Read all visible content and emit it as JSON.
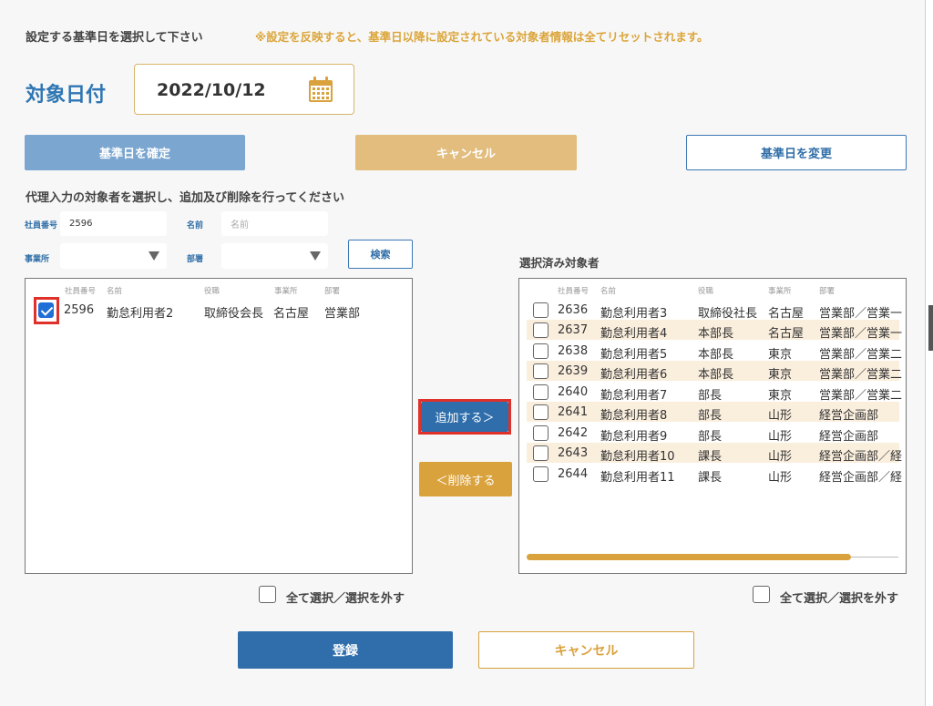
{
  "header": {
    "instruction": "設定する基準日を選択して下さい",
    "warning": "※設定を反映すると、基準日以降に設定されている対象者情報は全てリセットされます。"
  },
  "target_date": {
    "label": "対象日付",
    "value": "2022/10/12",
    "icon": "calendar-icon"
  },
  "date_buttons": {
    "confirm": "基準日を確定",
    "cancel": "キャンセル",
    "change": "基準日を変更"
  },
  "proxy": {
    "instruction": "代理入力の対象者を選択し、追加及び削除を行ってください"
  },
  "filters": {
    "employee_no_label": "社員番号",
    "employee_no_value": "2596",
    "name_label": "名前",
    "name_placeholder": "名前",
    "office_label": "事業所",
    "office_value": "",
    "dept_label": "部署",
    "dept_value": "",
    "search_button": "検索"
  },
  "columns": {
    "emp_no": "社員番号",
    "name": "名前",
    "position": "役職",
    "office": "事業所",
    "dept": "部署"
  },
  "left_list": [
    {
      "checked": true,
      "emp_no": "2596",
      "name": "勤怠利用者2",
      "position": "取締役会長",
      "office": "名古屋",
      "dept": "営業部"
    }
  ],
  "middle": {
    "add_button": "追加する＞",
    "remove_button": "＜削除する"
  },
  "selected": {
    "title": "選択済み対象者",
    "rows": [
      {
        "checked": false,
        "emp_no": "2636",
        "name": "勤怠利用者3",
        "position": "取締役社長",
        "office": "名古屋",
        "dept": "営業部／営業一"
      },
      {
        "checked": false,
        "emp_no": "2637",
        "name": "勤怠利用者4",
        "position": "本部長",
        "office": "名古屋",
        "dept": "営業部／営業一"
      },
      {
        "checked": false,
        "emp_no": "2638",
        "name": "勤怠利用者5",
        "position": "本部長",
        "office": "東京",
        "dept": "営業部／営業二"
      },
      {
        "checked": false,
        "emp_no": "2639",
        "name": "勤怠利用者6",
        "position": "本部長",
        "office": "東京",
        "dept": "営業部／営業二"
      },
      {
        "checked": false,
        "emp_no": "2640",
        "name": "勤怠利用者7",
        "position": "部長",
        "office": "東京",
        "dept": "営業部／営業二"
      },
      {
        "checked": false,
        "emp_no": "2641",
        "name": "勤怠利用者8",
        "position": "部長",
        "office": "山形",
        "dept": "経営企画部"
      },
      {
        "checked": false,
        "emp_no": "2642",
        "name": "勤怠利用者9",
        "position": "部長",
        "office": "山形",
        "dept": "経営企画部"
      },
      {
        "checked": false,
        "emp_no": "2643",
        "name": "勤怠利用者10",
        "position": "課長",
        "office": "山形",
        "dept": "経営企画部／経"
      },
      {
        "checked": false,
        "emp_no": "2644",
        "name": "勤怠利用者11",
        "position": "課長",
        "office": "山形",
        "dept": "経営企画部／経"
      }
    ]
  },
  "select_all": "全て選択／選択を外す",
  "footer": {
    "register": "登録",
    "cancel": "キャンセル"
  },
  "colors": {
    "primary_blue": "#2f6eab",
    "accent_gold": "#d9a23d",
    "highlight_red": "#e0302a",
    "row_stripe": "#faeedd"
  }
}
